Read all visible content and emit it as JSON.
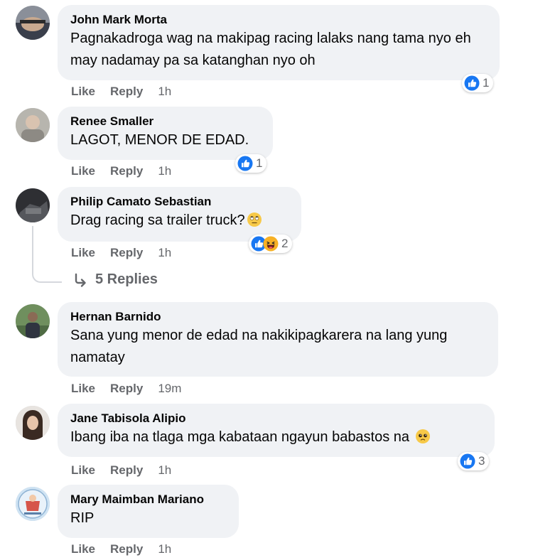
{
  "actions": {
    "like": "Like",
    "reply": "Reply"
  },
  "comments": [
    {
      "author": "John Mark Morta",
      "text": "Pagnakadroga wag na makipag racing lalaks nang tama nyo eh may nadamay pa sa katanghan nyo oh",
      "time": "1h",
      "reactions": {
        "types": [
          "like"
        ],
        "count": "1"
      }
    },
    {
      "author": "Renee Smaller",
      "text": "LAGOT, MENOR DE EDAD.",
      "time": "1h",
      "reactions": {
        "types": [
          "like"
        ],
        "count": "1"
      }
    },
    {
      "author": "Philip Camato Sebastian",
      "text": "Drag racing sa trailer truck?",
      "text_emoji": "rolling-eyes-emoji",
      "time": "1h",
      "reactions": {
        "types": [
          "like",
          "haha"
        ],
        "count": "2"
      },
      "replies_label": "5 Replies"
    },
    {
      "author": "Hernan Barnido",
      "text": "Sana yung menor de edad na nakikipagkarera na lang yung namatay",
      "time": "19m"
    },
    {
      "author": "Jane Tabisola Alipio",
      "text": "Ibang iba na tlaga mga kabataan ngayun babastos na",
      "text_emoji": "pleading-face-emoji",
      "time": "1h",
      "reactions": {
        "types": [
          "like"
        ],
        "count": "3"
      }
    },
    {
      "author": "Mary Maimban Mariano",
      "text": "RIP",
      "time": "1h"
    }
  ],
  "colors": {
    "bubble": "#f0f2f5",
    "meta_text": "#65676b",
    "like_blue": "#1877f2",
    "haha_yellow": "#f7b125"
  }
}
